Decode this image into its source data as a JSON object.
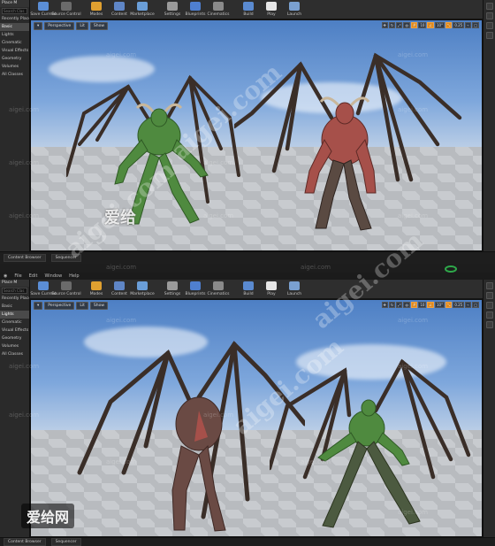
{
  "top_editor": {
    "left_panel": {
      "title": "Place M",
      "search_placeholder": "Search Clas",
      "items": [
        "Recently Placed",
        "Basic",
        "Lights",
        "Cinematic",
        "Visual Effects",
        "Geometry",
        "Volumes",
        "All Classes"
      ]
    },
    "toolbar": [
      {
        "label": "Save Current",
        "icon": "save-icon",
        "color": "#5b8ed6"
      },
      {
        "label": "Source Control",
        "icon": "source-control-icon",
        "color": "#6b6b6b"
      },
      {
        "label": "Modes",
        "icon": "modes-icon",
        "color": "#e0a030"
      },
      {
        "label": "Content",
        "icon": "content-icon",
        "color": "#5f86c6"
      },
      {
        "label": "Marketplace",
        "icon": "marketplace-icon",
        "color": "#6a9ed8"
      },
      {
        "label": "Settings",
        "icon": "gear-icon",
        "color": "#9a9a9a"
      },
      {
        "label": "Blueprints",
        "icon": "blueprints-icon",
        "color": "#4f7fd0"
      },
      {
        "label": "Cinematics",
        "icon": "cinematics-icon",
        "color": "#8a8a8a"
      },
      {
        "label": "Build",
        "icon": "build-icon",
        "color": "#5a8ad0"
      },
      {
        "label": "Play",
        "icon": "play-icon",
        "color": "#e6e6e6"
      },
      {
        "label": "Launch",
        "icon": "launch-icon",
        "color": "#7aa0d0"
      }
    ],
    "viewport": {
      "mode": "Perspective",
      "lighting": "Lit",
      "show": "Show",
      "snap_value": "0.25"
    },
    "bottom_tabs": [
      "Content Browser",
      "Sequencer"
    ]
  },
  "bottom_editor": {
    "menu": [
      "File",
      "Edit",
      "Window",
      "Help"
    ],
    "left_panel": {
      "title": "Place M",
      "search_placeholder": "Search Clas",
      "items": [
        "Recently Placed",
        "Basic",
        "Lights",
        "Cinematic",
        "Visual Effects",
        "Geometry",
        "Volumes",
        "All Classes"
      ]
    },
    "toolbar": [
      {
        "label": "Save Current",
        "icon": "save-icon",
        "color": "#5b8ed6"
      },
      {
        "label": "Source Control",
        "icon": "source-control-icon",
        "color": "#6b6b6b"
      },
      {
        "label": "Modes",
        "icon": "modes-icon",
        "color": "#e0a030"
      },
      {
        "label": "Content",
        "icon": "content-icon",
        "color": "#5f86c6"
      },
      {
        "label": "Marketplace",
        "icon": "marketplace-icon",
        "color": "#6a9ed8"
      },
      {
        "label": "Settings",
        "icon": "gear-icon",
        "color": "#9a9a9a"
      },
      {
        "label": "Blueprints",
        "icon": "blueprints-icon",
        "color": "#4f7fd0"
      },
      {
        "label": "Cinematics",
        "icon": "cinematics-icon",
        "color": "#8a8a8a"
      },
      {
        "label": "Build",
        "icon": "build-icon",
        "color": "#5a8ad0"
      },
      {
        "label": "Play",
        "icon": "play-icon",
        "color": "#e6e6e6"
      },
      {
        "label": "Launch",
        "icon": "launch-icon",
        "color": "#7aa0d0"
      }
    ],
    "viewport": {
      "mode": "Perspective",
      "lighting": "Lit",
      "show": "Show",
      "snap_value": "0.25"
    },
    "bottom_tabs": [
      "Content Browser",
      "Sequencer"
    ]
  },
  "watermarks": {
    "site": "aigei.com",
    "logo_cn": "爱给",
    "logo_cn_full": "爱给网"
  },
  "colors": {
    "accent_orange": "#e08a1e",
    "creature_green": "#4f8a3f",
    "creature_red": "#a6504a",
    "record_ring": "#2ea84a"
  }
}
